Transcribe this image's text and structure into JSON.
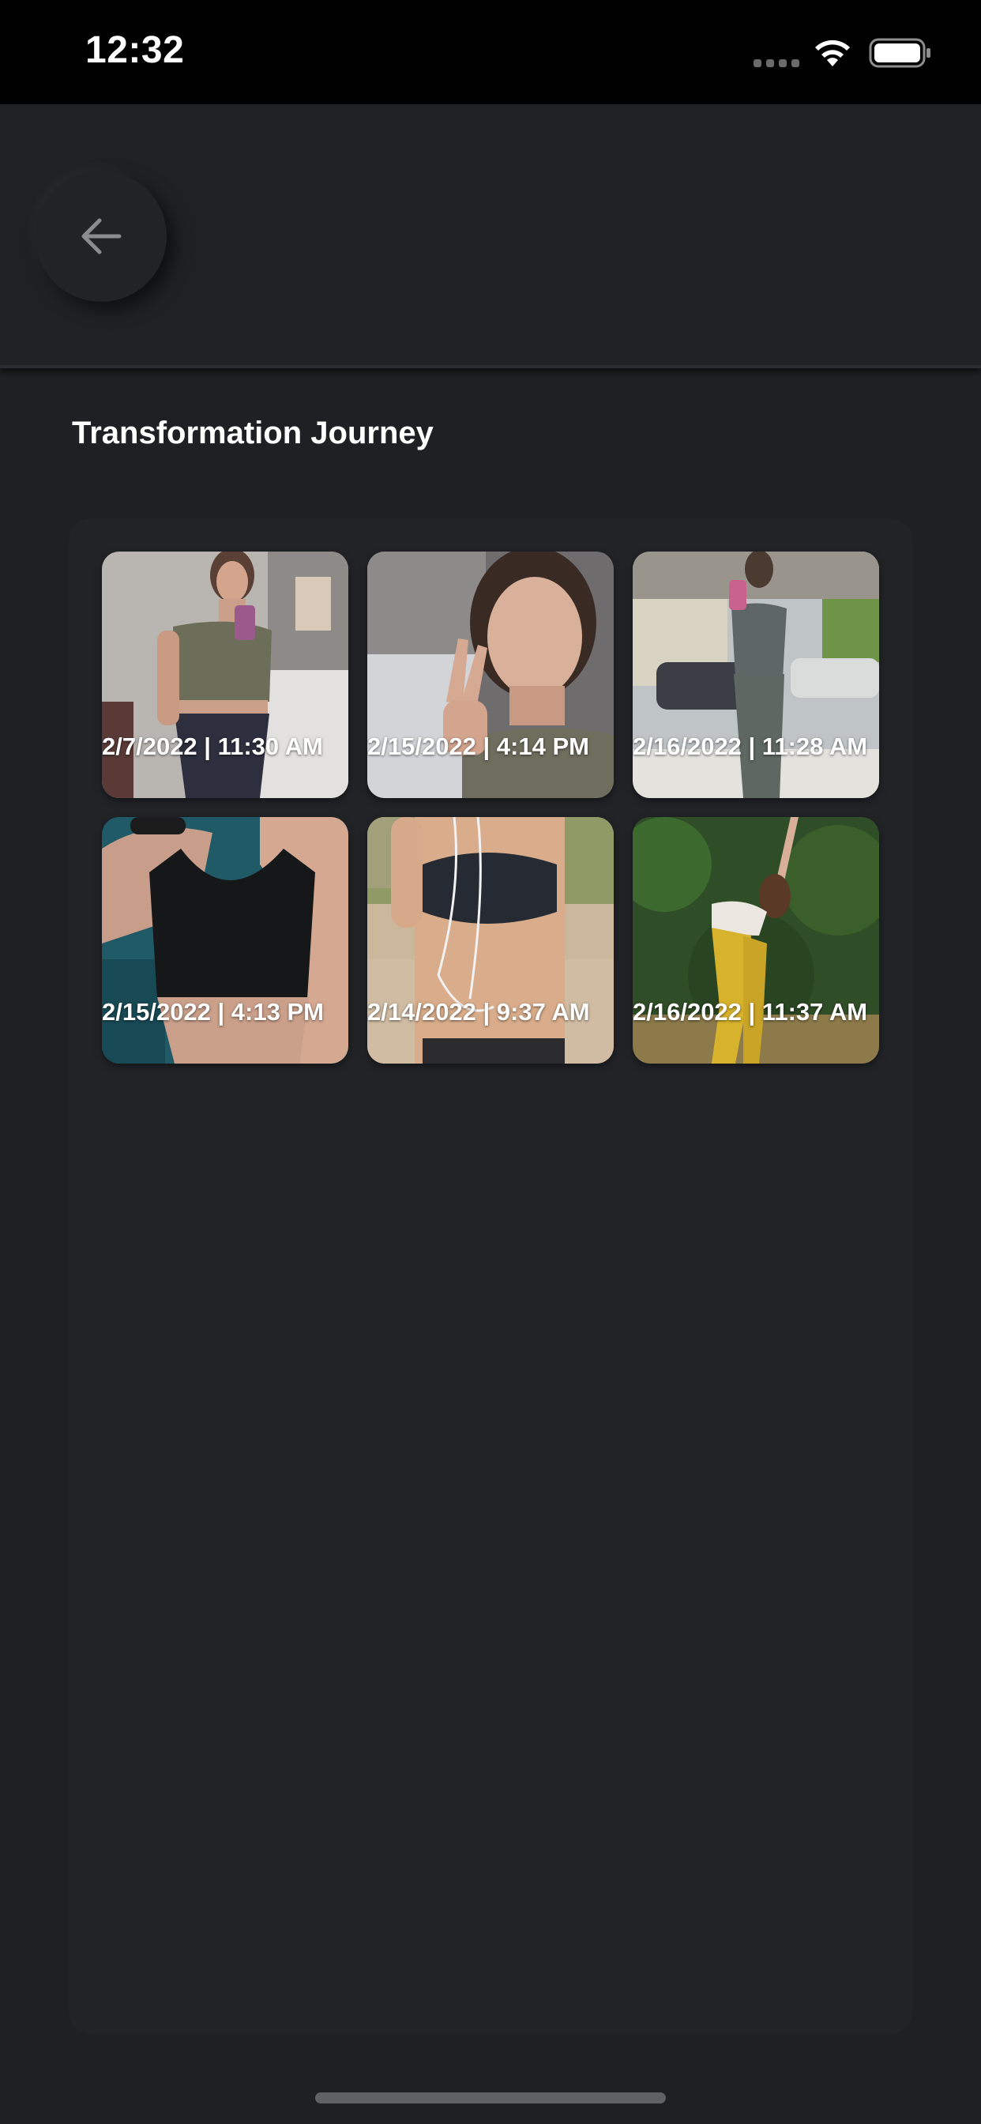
{
  "status_bar": {
    "time": "12:32"
  },
  "header": {
    "back_icon": "arrow-left-icon"
  },
  "page_title": "Transformation Journey",
  "photos": [
    {
      "caption": "2/7/2022 | 11:30 AM"
    },
    {
      "caption": "2/15/2022 | 4:14 PM"
    },
    {
      "caption": "2/16/2022 | 11:28 AM"
    },
    {
      "caption": "2/15/2022 | 4:13 PM"
    },
    {
      "caption": "2/14/2022 | 9:37 AM"
    },
    {
      "caption": "2/16/2022 | 11:37 AM"
    }
  ],
  "colors": {
    "status_bar": "#000000",
    "background": "#1e2024",
    "panel": "#212327",
    "text": "#ffffff"
  }
}
